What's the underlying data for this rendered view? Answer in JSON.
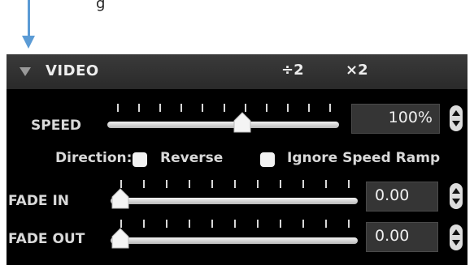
{
  "caption": "g",
  "panel": {
    "title": "VIDEO",
    "halve_label": "÷2",
    "double_label": "×2"
  },
  "speed": {
    "label": "SPEED",
    "value": "100%",
    "slider_position": 0.59
  },
  "direction": {
    "label": "Direction:",
    "reverse_label": "Reverse",
    "reverse_checked": false,
    "ignore_ramp_label": "Ignore Speed Ramp",
    "ignore_ramp_checked": false
  },
  "fade_in": {
    "label": "FADE IN",
    "value": "0.00",
    "slider_position": 0.0
  },
  "fade_out": {
    "label": "FADE OUT",
    "value": "0.00",
    "slider_position": 0.0
  },
  "colors": {
    "panel_bg": "#000000",
    "header_bg": "#333333",
    "accent_arrow": "#5b9bd5",
    "track": "#d0d0d0"
  }
}
